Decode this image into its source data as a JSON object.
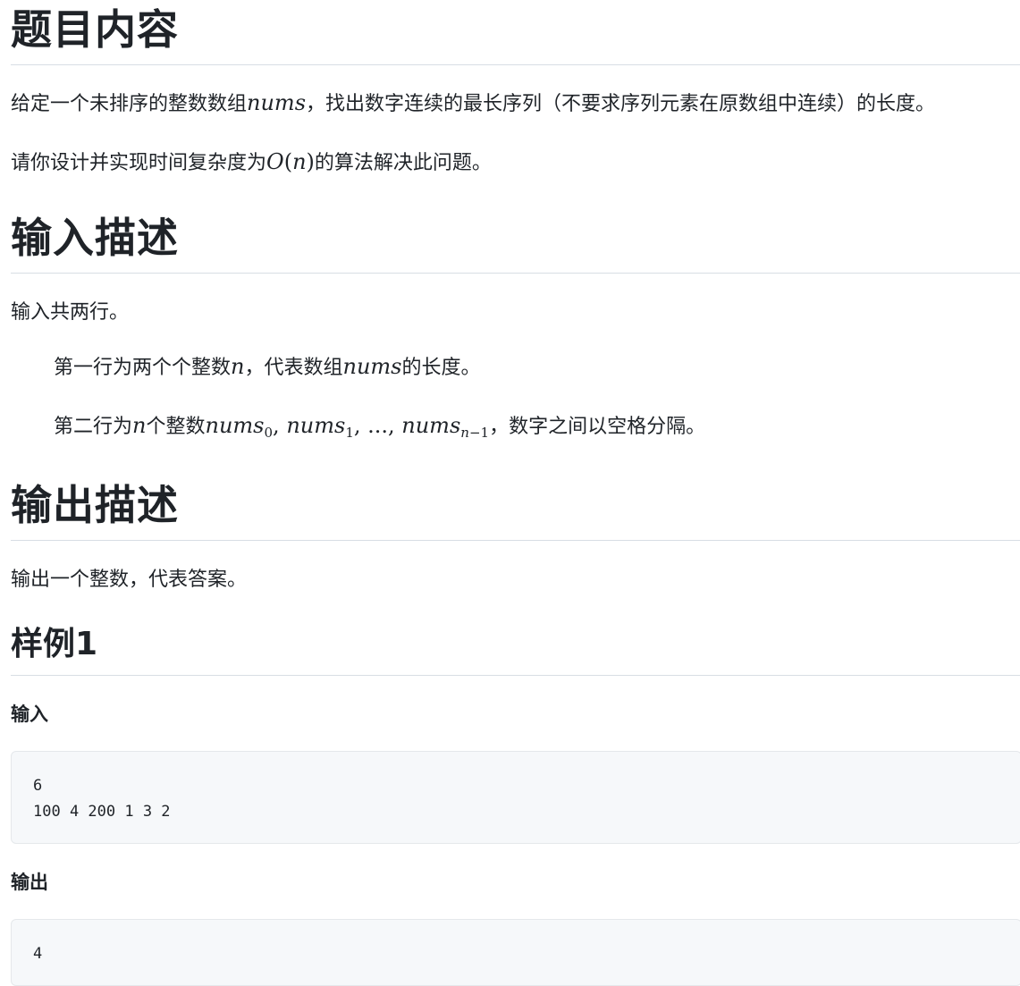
{
  "problem": {
    "title": "题目内容",
    "desc_1_before": "给定一个未排序的整数数组",
    "desc_1_var": "nums",
    "desc_1_after": "，找出数字连续的最长序列（不要求序列元素在原数组中连续）的长度。",
    "desc_2_before": "请你设计并实现时间复杂度为",
    "desc_2_O": "O",
    "desc_2_lp": "(",
    "desc_2_n": "n",
    "desc_2_rp": ")",
    "desc_2_after": "的算法解决此问题。"
  },
  "input": {
    "title": "输入描述",
    "line_0": "输入共两行。",
    "line_1_a": "第一行为两个个整数",
    "line_1_n": "n",
    "line_1_b": "，代表数组",
    "line_1_nums": "nums",
    "line_1_c": "的长度。",
    "line_2_a": "第二行为",
    "line_2_n": "n",
    "line_2_b": "个整数",
    "line_2_nums0": "nums",
    "line_2_sub0": "0",
    "line_2_comma1": ", ",
    "line_2_nums1": "nums",
    "line_2_sub1": "1",
    "line_2_dots": ", ..., ",
    "line_2_nums2": "nums",
    "line_2_sub2_n": "n",
    "line_2_sub2_rest": "−1",
    "line_2_c": "，数字之间以空格分隔。"
  },
  "output": {
    "title": "输出描述",
    "line_0": "输出一个整数，代表答案。"
  },
  "sample": {
    "title": "样例1",
    "input_label": "输入",
    "input_code": "6\n100 4 200 1 3 2",
    "output_label": "输出",
    "output_code": "4"
  }
}
